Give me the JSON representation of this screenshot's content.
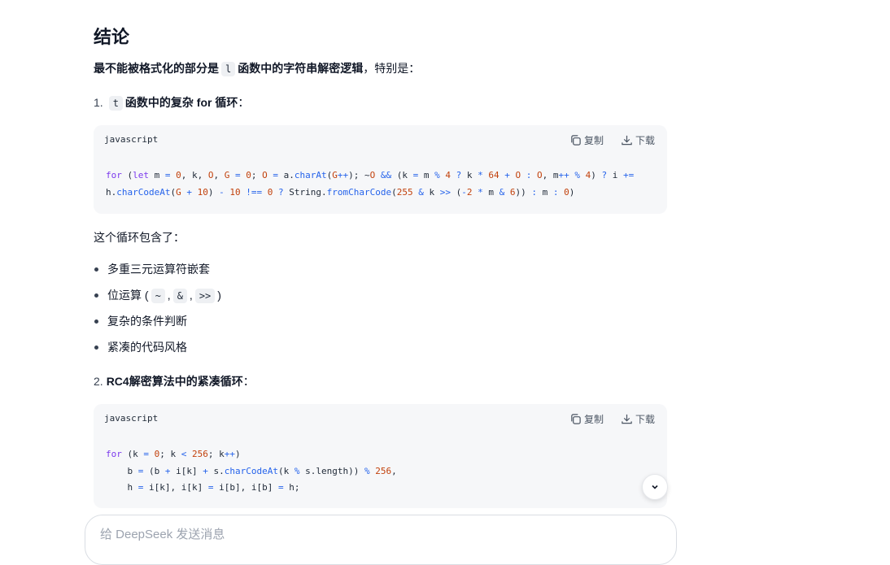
{
  "section": {
    "title": "结论",
    "lead_bold": "最不能被格式化的部分是",
    "lead_code": "l",
    "lead_bold_after": "函数中的字符串解密逻辑",
    "lead_rest": "，特别是："
  },
  "item1": {
    "num": "1.",
    "code": "t",
    "label": "函数中的复杂 for 循环",
    "colon": "："
  },
  "codeblock1": {
    "lang": "javascript",
    "copy": "复制",
    "download": "下载"
  },
  "para1": "这个循环包含了：",
  "bullets": {
    "b0": "多重三元运算符嵌套",
    "b1_prefix": "位运算 (",
    "b1_c1": "~",
    "b1_c2": "&",
    "b1_c3": ">>",
    "b1_suffix": ")",
    "b2": "复杂的条件判断",
    "b3": "紧凑的代码风格"
  },
  "item2": {
    "num": "2.",
    "label": "RC4解密算法中的紧凑循环",
    "colon": "："
  },
  "codeblock2": {
    "lang": "javascript",
    "copy": "复制",
    "download": "下载"
  },
  "composer": {
    "placeholder": "给 DeepSeek 发送消息"
  },
  "icons": {
    "copy": "copy-icon",
    "download": "download-icon",
    "scroll": "chevron-down-icon"
  }
}
